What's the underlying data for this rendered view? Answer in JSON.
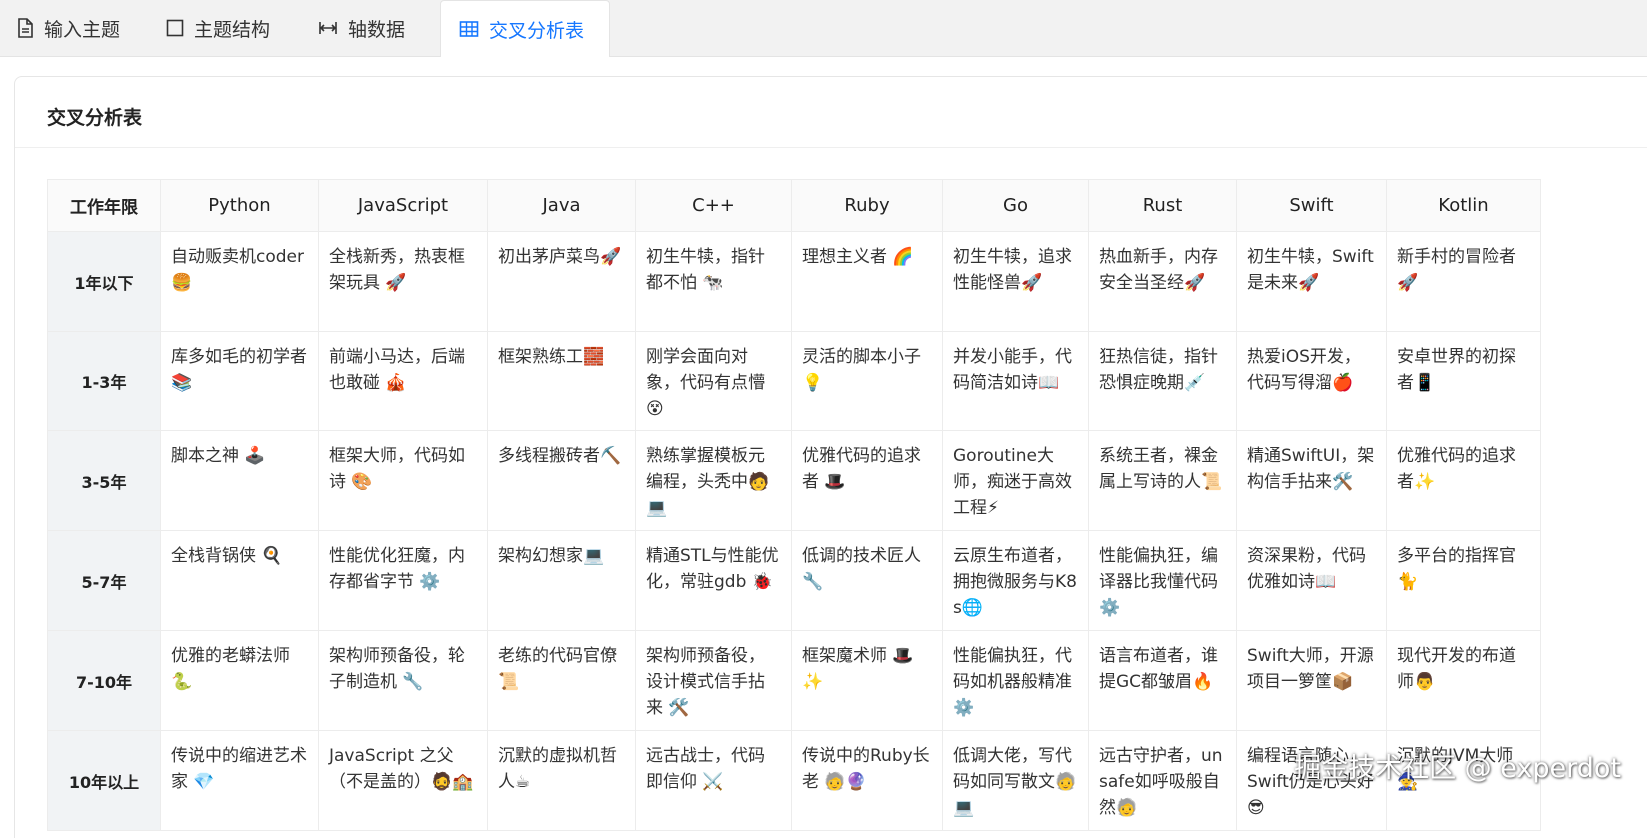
{
  "tabs": [
    {
      "label": "输入主题",
      "icon": "file-icon"
    },
    {
      "label": "主题结构",
      "icon": "square-icon"
    },
    {
      "label": "轴数据",
      "icon": "axis-icon"
    },
    {
      "label": "交叉分析表",
      "icon": "table-icon",
      "active": true
    }
  ],
  "colors": {
    "accent": "#1677ff",
    "header_bg": "#fafafa",
    "rowhead_bg": "#f1f3f5"
  },
  "card": {
    "title": "交叉分析表"
  },
  "table": {
    "corner": "工作年限",
    "columns": [
      "Python",
      "JavaScript",
      "Java",
      "C++",
      "Ruby",
      "Go",
      "Rust",
      "Swift",
      "Kotlin"
    ],
    "rows": [
      {
        "label": "1年以下",
        "cells": [
          "自动贩卖机coder 🍔",
          "全栈新秀，热衷框架玩具 🚀",
          "初出茅庐菜鸟🚀",
          "初生牛犊，指针都不怕 🐄",
          "理想主义者 🌈",
          "初生牛犊，追求性能怪兽🚀",
          "热血新手，内存安全当圣经🚀",
          "初生牛犊，Swift是未来🚀",
          "新手村的冒险者🚀"
        ]
      },
      {
        "label": "1-3年",
        "cells": [
          "库多如毛的初学者📚",
          "前端小马达，后端也敢碰 🎪",
          "框架熟练工🧱",
          "刚学会面向对象，代码有点懵😵",
          "灵活的脚本小子💡",
          "并发小能手，代码简洁如诗📖",
          "狂热信徒，指针恐惧症晚期💉",
          "热爱iOS开发，代码写得溜🍎",
          "安卓世界的初探者📱"
        ]
      },
      {
        "label": "3-5年",
        "cells": [
          "脚本之神 🕹️",
          "框架大师，代码如诗 🎨",
          "多线程搬砖者⛏️",
          "熟练掌握模板元编程，头秃中🧑💻",
          "优雅代码的追求者 🎩",
          "Goroutine大师，痴迷于高效工程⚡",
          "系统王者，裸金属上写诗的人📜",
          "精通SwiftUI，架构信手拈来🛠️",
          "优雅代码的追求者✨"
        ]
      },
      {
        "label": "5-7年",
        "cells": [
          "全栈背锅侠 🍳",
          "性能优化狂魔，内存都省字节 ⚙️",
          "架构幻想家💻",
          "精通STL与性能优化，常驻gdb 🐞",
          "低调的技术匠人🔧",
          "云原生布道者，拥抱微服务与K8s🌐",
          "性能偏执狂，编译器比我懂代码⚙️",
          "资深果粉，代码优雅如诗📖",
          "多平台的指挥官🐈"
        ]
      },
      {
        "label": "7-10年",
        "cells": [
          "优雅的老蟒法师🐍",
          "架构师预备役，轮子制造机 🔧",
          "老练的代码官僚📜",
          "架构师预备役，设计模式信手拈来 🛠️",
          "框架魔术师 🎩✨",
          "性能偏执狂，代码如机器般精准⚙️",
          "语言布道者，谁提GC都皱眉🔥",
          "Swift大师，开源项目一箩筐📦",
          "现代开发的布道师👨"
        ]
      },
      {
        "label": "10年以上",
        "cells": [
          "传说中的缩进艺术家 💎",
          "JavaScript 之父（不是盖的）🧔🏫",
          "沉默的虚拟机哲人☕",
          "远古战士，代码即信仰 ⚔️",
          "传说中的Ruby长老 🧓🔮",
          "低调大佬，写代码如同写散文🧓💻",
          "远古守护者，unsafe如呼吸般自然🧓",
          "编程语言随心，Swift仍是心头好😎",
          "沉默的JVM大师🧙"
        ]
      }
    ]
  },
  "watermark": "掘金技术社区 @ experdot"
}
